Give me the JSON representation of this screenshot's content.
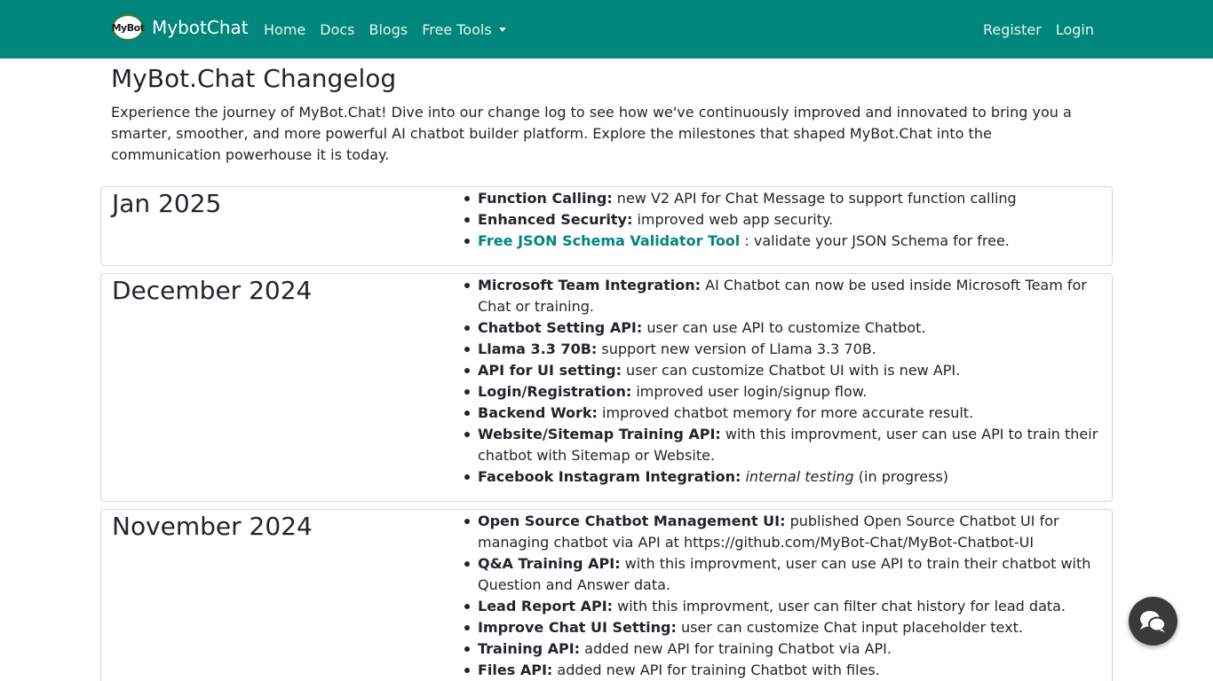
{
  "nav": {
    "logo_text": "MyBot",
    "brand": "MybotChat",
    "links": [
      "Home",
      "Docs",
      "Blogs",
      "Free Tools"
    ],
    "right": [
      "Register",
      "Login"
    ]
  },
  "page": {
    "title": "MyBot.Chat Changelog",
    "intro": "Experience the journey of MyBot.Chat! Dive into our change log to see how we've continuously improved and innovated to bring you a smarter, smoother, and more powerful AI chatbot builder platform. Explore the milestones that shaped MyBot.Chat into the communication powerhouse it is today."
  },
  "changelog": [
    {
      "month": "Jan 2025",
      "items": [
        {
          "title": "Function Calling:",
          "text": " new V2 API for Chat Message to support function calling"
        },
        {
          "title": "Enhanced Security:",
          "text": " improved web app security."
        },
        {
          "link": "Free JSON Schema Validator Tool",
          "text": " : validate your JSON Schema for free."
        }
      ]
    },
    {
      "month": "December 2024",
      "items": [
        {
          "title": "Microsoft Team Integration:",
          "text": " AI Chatbot can now be used inside Microsoft Team for Chat or training."
        },
        {
          "title": "Chatbot Setting API:",
          "text": " user can use API to customize Chatbot."
        },
        {
          "title": "Llama 3.3 70B:",
          "text": " support new version of Llama 3.3 70B."
        },
        {
          "title": "API for UI setting:",
          "text": " user can customize Chatbot UI with is new API."
        },
        {
          "title": "Login/Registration:",
          "text": " improved user login/signup flow."
        },
        {
          "title": "Backend Work:",
          "text": " improved chatbot memory for more accurate result."
        },
        {
          "title": "Website/Sitemap Training API:",
          "text": " with this improvment, user can use API to train their chatbot with Sitemap or Website."
        },
        {
          "title": "Facebook Instagram Integration:",
          "italic": "internal testing",
          "text": " (in progress)"
        }
      ]
    },
    {
      "month": "November 2024",
      "items": [
        {
          "title": "Open Source Chatbot Management UI:",
          "text": " published Open Source Chatbot UI for managing chatbot via API at https://github.com/MyBot-Chat/MyBot-Chatbot-UI"
        },
        {
          "title": "Q&A Training API:",
          "text": " with this improvment, user can use API to train their chatbot with Question and Answer data."
        },
        {
          "title": "Lead Report API:",
          "text": " with this improvment, user can filter chat history for lead data."
        },
        {
          "title": "Improve Chat UI Setting:",
          "text": " user can customize Chat input placeholder text."
        },
        {
          "title": "Training API:",
          "text": " added new API for training Chatbot via API."
        },
        {
          "title": "Files API:",
          "text": " added new API for training Chatbot with files."
        }
      ]
    }
  ],
  "icons": {
    "chat_fab": "chat-bubbles-icon",
    "dropdown": "caret-down-icon"
  },
  "colors": {
    "navbar": "#00867c",
    "link": "#00867c",
    "fab": "#3a3a3a"
  }
}
